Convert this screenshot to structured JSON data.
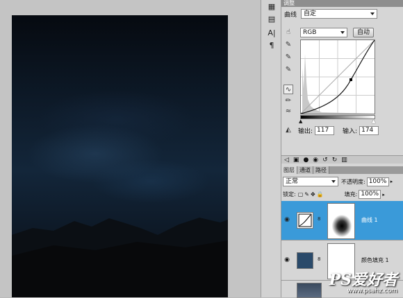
{
  "panel": {
    "title": "调整",
    "preset_label": "曲线",
    "preset_value": "自定",
    "channel": "RGB",
    "auto_label": "自动",
    "output_label": "输出:",
    "output_value": "117",
    "input_label": "输入:",
    "input_value": "174"
  },
  "layers": {
    "tabs": [
      "图层",
      "通道",
      "路径"
    ],
    "blend_mode": "正常",
    "opacity_label": "不透明度:",
    "opacity_value": "100%",
    "lock_label": "锁定:",
    "fill_label": "填充:",
    "fill_value": "100%",
    "items": [
      {
        "name": "曲线 1",
        "selected": true
      },
      {
        "name": "颜色填充 1",
        "selected": false
      }
    ]
  },
  "watermark": {
    "brand": "PS爱好者",
    "url": "www.psahz.com"
  },
  "colors": {
    "selected": "#3a9ad9",
    "fill_swatch": "#2a4a6a"
  }
}
